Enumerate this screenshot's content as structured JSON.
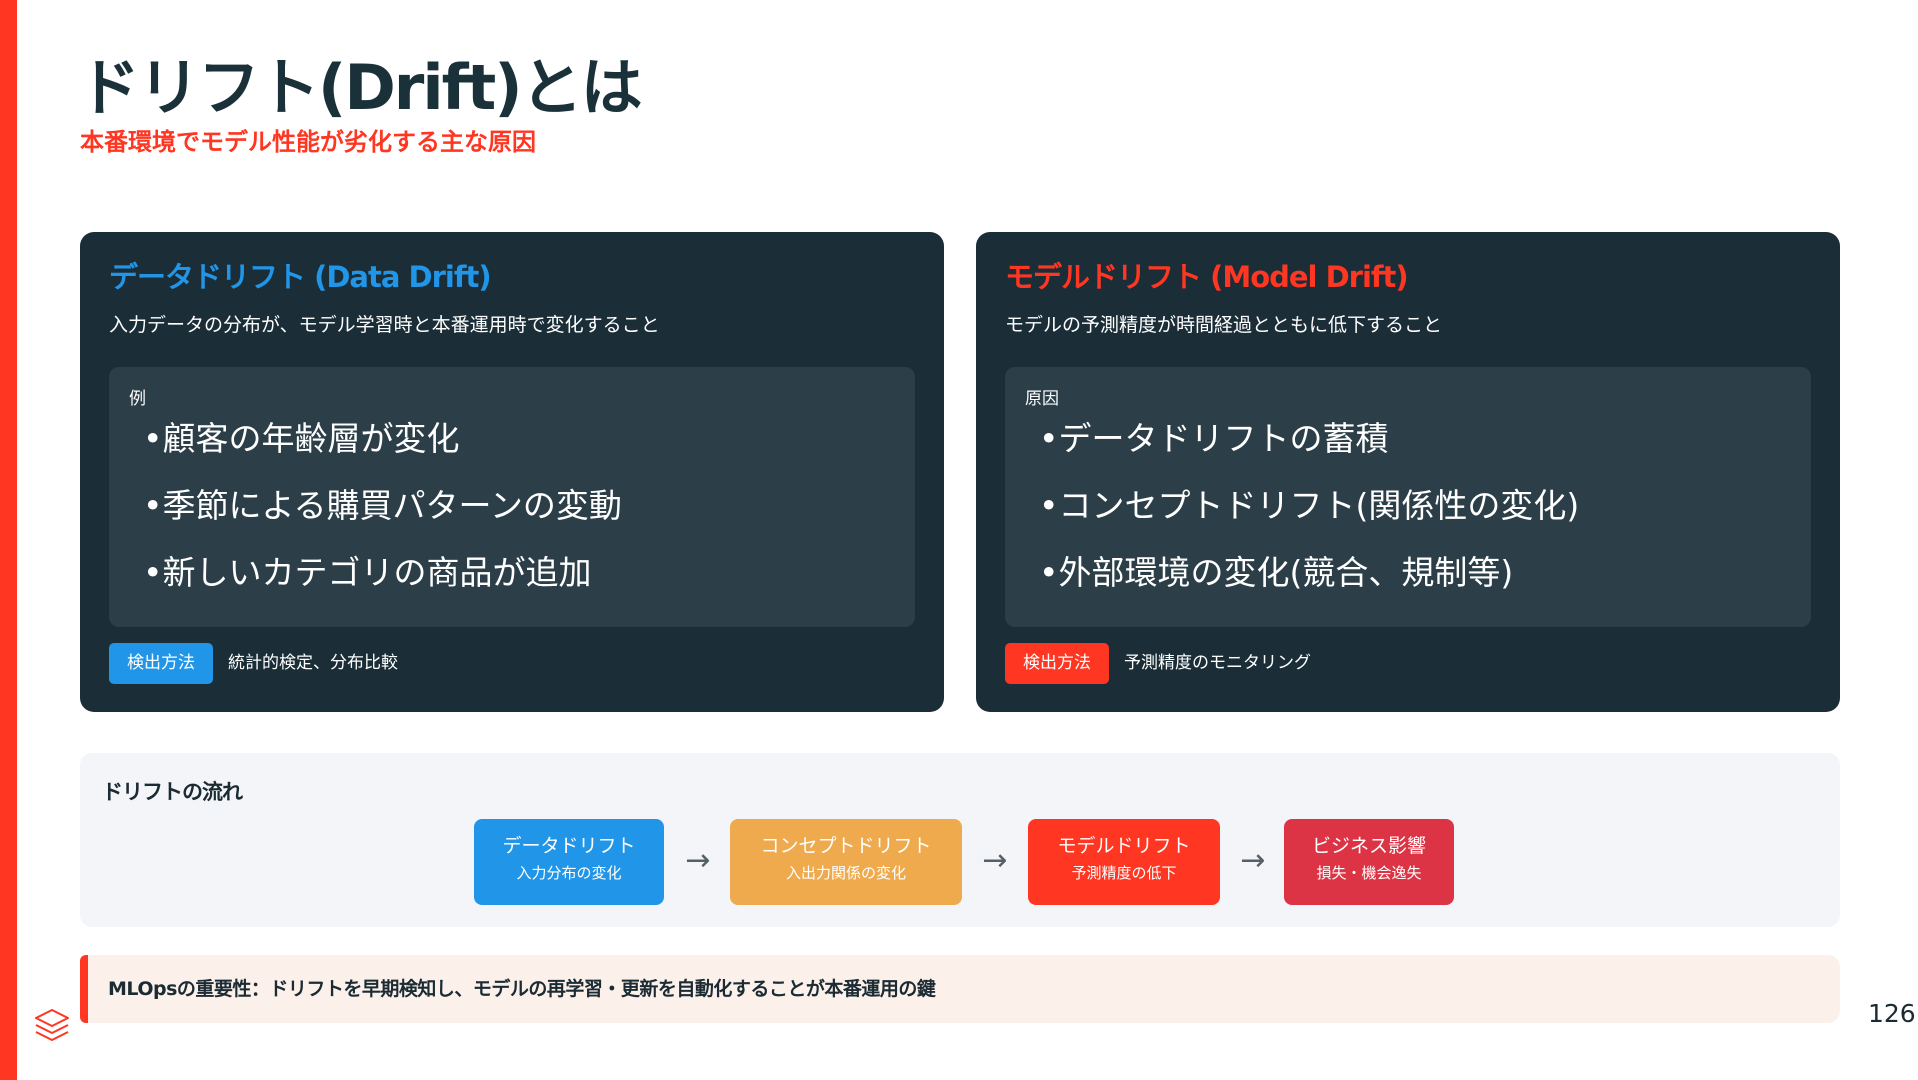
{
  "header": {
    "title": "ドリフト(Drift)とは",
    "subtitle": "本番環境でモデル性能が劣化する主な原因"
  },
  "cards": [
    {
      "title": "データドリフト (Data Drift)",
      "description": "入力データの分布が、モデル学習時と本番運用時で変化すること",
      "inner_label": "例",
      "items": [
        "顧客の年齢層が変化",
        "季節による購買パターンの変動",
        "新しいカテゴリの商品が追加"
      ],
      "badge": "検出方法",
      "method": "統計的検定、分布比較"
    },
    {
      "title": "モデルドリフト (Model Drift)",
      "description": "モデルの予測精度が時間経過とともに低下すること",
      "inner_label": "原因",
      "items": [
        "データドリフトの蓄積",
        "コンセプトドリフト(関係性の変化)",
        "外部環境の変化(競合、規制等)"
      ],
      "badge": "検出方法",
      "method": "予測精度のモニタリング"
    }
  ],
  "flow": {
    "title": "ドリフトの流れ",
    "arrow": "→",
    "steps": [
      {
        "title": "データドリフト",
        "sub": "入力分布の変化",
        "color": "#2196e8"
      },
      {
        "title": "コンセプトドリフト",
        "sub": "入出力関係の変化",
        "color": "#efaa4d"
      },
      {
        "title": "モデルドリフト",
        "sub": "予測精度の低下",
        "color": "#ff3621"
      },
      {
        "title": "ビジネス影響",
        "sub": "損失・機会逸失",
        "color": "#dc3445"
      }
    ]
  },
  "note": {
    "text": "MLOpsの重要性：ドリフトを早期検知し、モデルの再学習・更新を自動化することが本番運用の鍵"
  },
  "footer": {
    "logo_icon": "layers-logo-icon",
    "page_number": "126"
  },
  "colors": {
    "accent": "#ff3621",
    "blue": "#2196e8",
    "navy": "#1b2e38"
  }
}
